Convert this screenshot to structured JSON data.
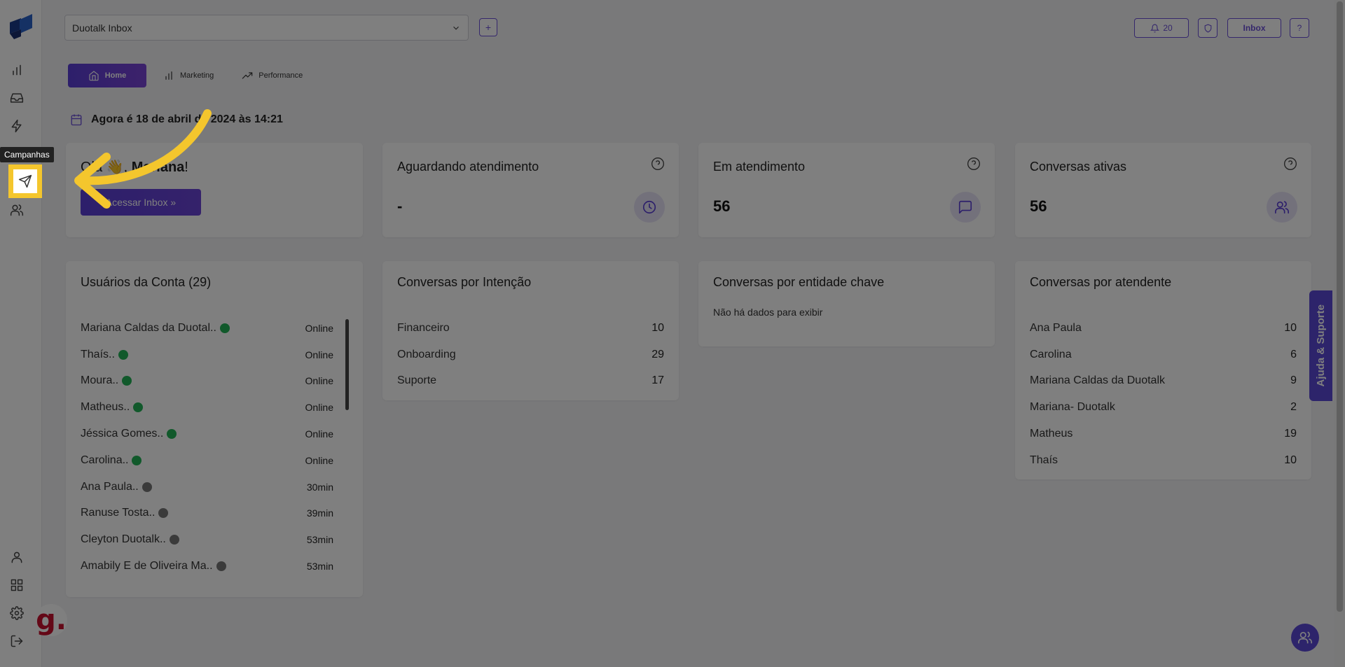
{
  "sidebar": {
    "tooltip": "Campanhas",
    "items": [
      "chart-icon",
      "inbox-icon",
      "bolt-icon",
      "send-icon",
      "users-icon"
    ],
    "bottom_items": [
      "user-icon",
      "grid-icon",
      "gear-icon",
      "logout-icon"
    ]
  },
  "topbar": {
    "inbox_select": "Duotalk Inbox",
    "plus": "+",
    "notifications_count": "20",
    "inbox_button": "Inbox",
    "help_button": "?"
  },
  "tabs": [
    {
      "label": "Home",
      "active": true
    },
    {
      "label": "Marketing",
      "active": false
    },
    {
      "label": "Performance",
      "active": false
    }
  ],
  "date_line": "Agora é 18 de abril de 2024 às 14:21",
  "greeting": {
    "prefix": "Olá 👋,",
    "name": "Mariana",
    "suffix": "!",
    "button": "Acessar Inbox »"
  },
  "stats": [
    {
      "title": "Aguardando atendimento",
      "value": "-",
      "icon": "clock-icon"
    },
    {
      "title": "Em atendimento",
      "value": "56",
      "icon": "chat-icon"
    },
    {
      "title": "Conversas ativas",
      "value": "56",
      "icon": "users-icon"
    }
  ],
  "users_card": {
    "title": "Usuários da Conta (29)",
    "rows": [
      {
        "name": "Mariana Caldas da Duotal..",
        "status": "Online",
        "online": true
      },
      {
        "name": "Thaís..",
        "status": "Online",
        "online": true
      },
      {
        "name": "Moura..",
        "status": "Online",
        "online": true
      },
      {
        "name": "Matheus..",
        "status": "Online",
        "online": true
      },
      {
        "name": "Jéssica Gomes..",
        "status": "Online",
        "online": true
      },
      {
        "name": "Carolina..",
        "status": "Online",
        "online": true
      },
      {
        "name": "Ana Paula..",
        "status": "30min",
        "online": false
      },
      {
        "name": "Ranuse Tosta..",
        "status": "39min",
        "online": false
      },
      {
        "name": "Cleyton Duotalk..",
        "status": "53min",
        "online": false
      },
      {
        "name": "Amabily E de Oliveira Ma..",
        "status": "53min",
        "online": false
      }
    ]
  },
  "intent_card": {
    "title": "Conversas por Intenção",
    "rows": [
      {
        "label": "Financeiro",
        "value": "10"
      },
      {
        "label": "Onboarding",
        "value": "29"
      },
      {
        "label": "Suporte",
        "value": "17"
      }
    ]
  },
  "entity_card": {
    "title": "Conversas por entidade chave",
    "empty": "Não há dados para exibir"
  },
  "agent_card": {
    "title": "Conversas por atendente",
    "rows": [
      {
        "label": "Ana Paula",
        "value": "10"
      },
      {
        "label": "Carolina",
        "value": "6"
      },
      {
        "label": "Mariana Caldas da Duotalk",
        "value": "9"
      },
      {
        "label": "Mariana- Duotalk",
        "value": "2"
      },
      {
        "label": "Matheus",
        "value": "19"
      },
      {
        "label": "Thaís",
        "value": "10"
      }
    ]
  },
  "help_tab": "Ajuda & Suporte",
  "g_badge": "g.",
  "colors": {
    "accent": "#5a3fd6",
    "highlight": "#f4c62d",
    "online": "#22b357"
  }
}
